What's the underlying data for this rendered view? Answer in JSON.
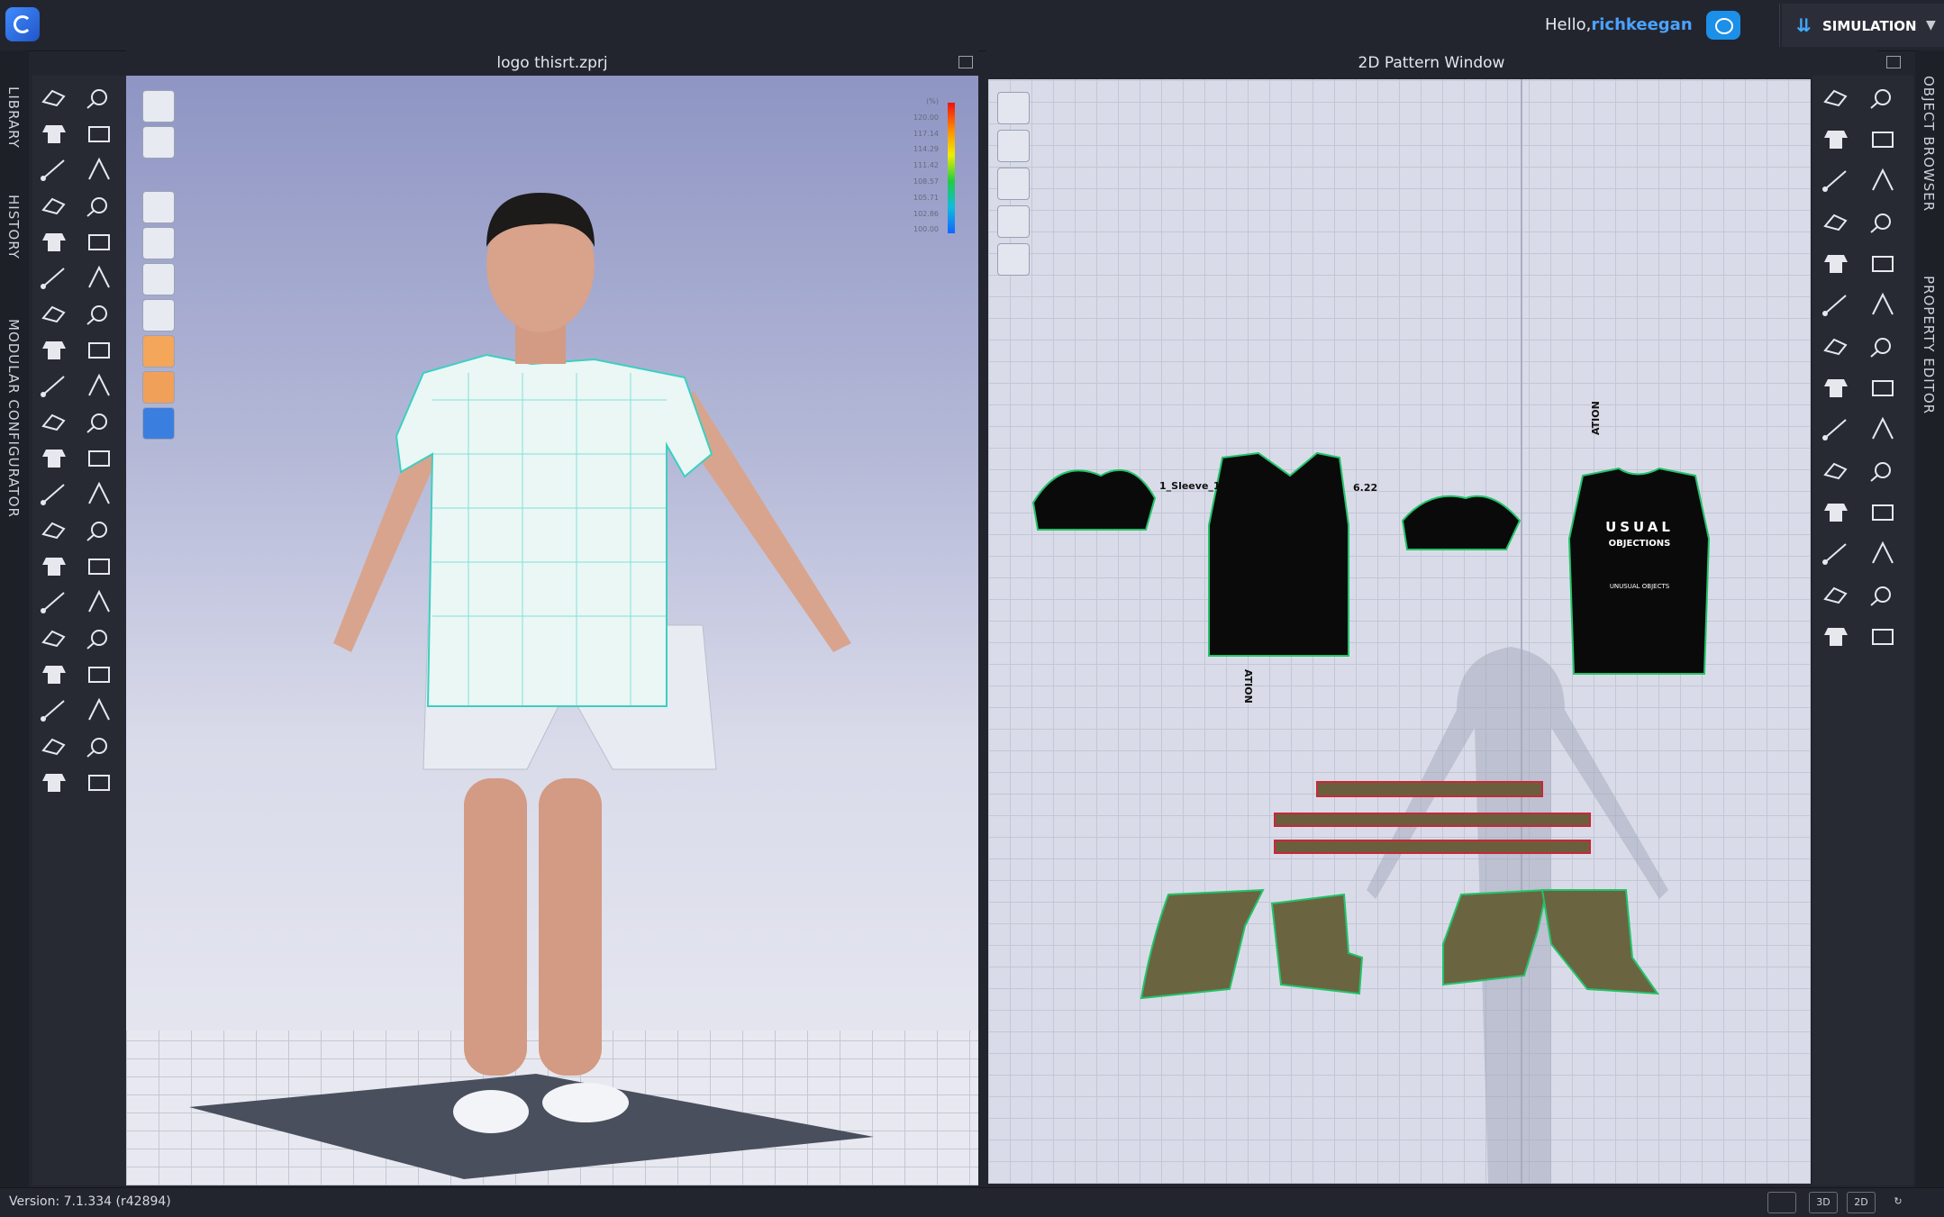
{
  "header": {
    "greeting_prefix": "Hello,",
    "username": "richkeegan",
    "cloud_button": "C",
    "mode": "SIMULATION"
  },
  "left_tabs": [
    "LIBRARY",
    "HISTORY",
    "MODULAR CONFIGURATOR"
  ],
  "right_tabs": [
    "OBJECT BROWSER",
    "PROPERTY EDITOR"
  ],
  "window_3d": {
    "title": "logo thisrt.zprj"
  },
  "window_2d": {
    "title": "2D Pattern Window"
  },
  "strain_scale": {
    "unit": "(%)",
    "values": [
      "120.00",
      "117.14",
      "114.29",
      "111.42",
      "108.57",
      "105.71",
      "102.86",
      "100.00"
    ]
  },
  "pattern_labels": {
    "piece_a": "1_Sleeve_1",
    "front_label": "6.22",
    "side_label": "ATION",
    "back_label": "ATION",
    "logo_line1": "USUAL",
    "logo_line2": "OBJECTIONS",
    "logo_line3": "UNUSUAL OBJECTS"
  },
  "status": {
    "version": "Version: 7.1.334 (r42894)",
    "btn_3d": "3D",
    "btn_2d": "2D"
  },
  "colors": {
    "accent": "#3fa9ff",
    "username": "#4aa3ff",
    "background": "#23252e"
  }
}
